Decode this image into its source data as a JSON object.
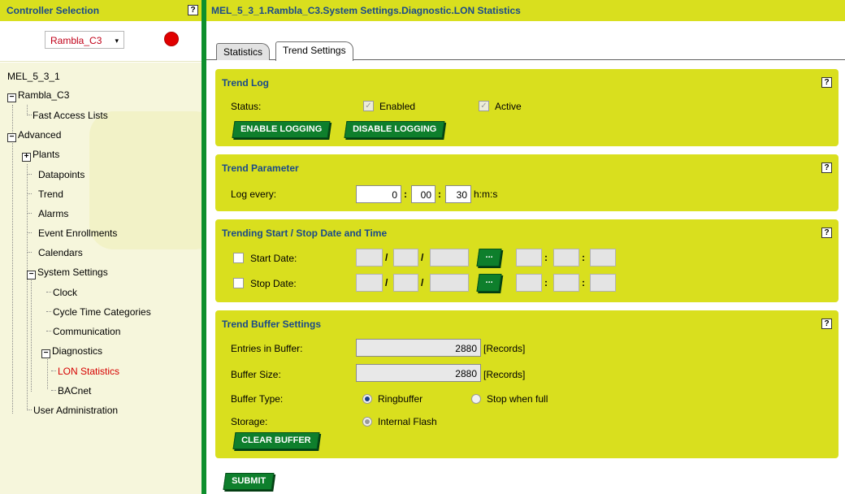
{
  "left_panel": {
    "title": "Controller Selection",
    "help": "?",
    "controller": {
      "value": "Rambla_C3",
      "arrow": "▾"
    },
    "status_color": "#e10000"
  },
  "tree": {
    "root": "MEL_5_3_1",
    "rambla": "Rambla_C3",
    "fast_access": "Fast Access Lists",
    "advanced": "Advanced",
    "plants": "Plants",
    "datapoints": "Datapoints",
    "trend": "Trend",
    "alarms": "Alarms",
    "event_enrollments": "Event Enrollments",
    "calendars": "Calendars",
    "system_settings": "System Settings",
    "clock": "Clock",
    "cycle_time": "Cycle Time Categories",
    "communication": "Communication",
    "diagnostics": "Diagnostics",
    "lon_statistics": "LON Statistics",
    "bacnet": "BACnet",
    "user_admin": "User Administration",
    "collapse": "−",
    "expand": "+"
  },
  "main": {
    "breadcrumb": "MEL_5_3_1.Rambla_C3.System Settings.Diagnostic.LON Statistics",
    "tabs": [
      "Statistics",
      "Trend Settings"
    ],
    "help": "?"
  },
  "trend_log": {
    "title": "Trend Log",
    "status_label": "Status:",
    "enabled_label": "Enabled",
    "active_label": "Active",
    "enable_btn": "ENABLE LOGGING",
    "disable_btn": "DISABLE LOGGING",
    "check": "✓"
  },
  "trend_param": {
    "title": "Trend Parameter",
    "log_every_label": "Log every:",
    "hours": "0",
    "minutes": "00",
    "seconds": "30",
    "unit": "h:m:s"
  },
  "start_stop": {
    "title": "Trending Start / Stop Date and Time",
    "start_label": "Start Date:",
    "stop_label": "Stop Date:",
    "date_sep": "/",
    "time_sep": ":",
    "cal_btn": "..."
  },
  "buffer": {
    "title": "Trend Buffer Settings",
    "entries_label": "Entries in Buffer:",
    "entries_value": "2880",
    "size_label": "Buffer Size:",
    "size_value": "2880",
    "records_unit": "[Records]",
    "type_label": "Buffer Type:",
    "ringbuffer": "Ringbuffer",
    "stop_when_full": "Stop when full",
    "storage_label": "Storage:",
    "internal_flash": "Internal Flash",
    "clear_btn": "CLEAR BUFFER"
  },
  "submit_btn": "SUBMIT"
}
